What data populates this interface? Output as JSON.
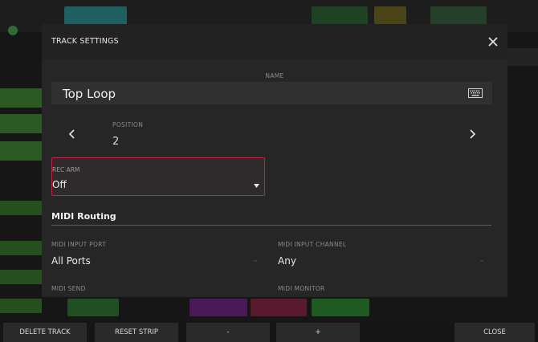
{
  "modal": {
    "title": "TRACK SETTINGS",
    "name_label": "NAME",
    "name_value": "Top Loop",
    "position_label": "POSITION",
    "position_value": "2",
    "rec_arm_label": "REC ARM",
    "rec_arm_value": "Off",
    "midi_section_title": "MIDI Routing",
    "midi_input_port_label": "MIDI INPUT PORT",
    "midi_input_port_value": "All Ports",
    "midi_input_channel_label": "MIDI INPUT CHANNEL",
    "midi_input_channel_value": "Any",
    "midi_send_label": "MIDI SEND",
    "midi_monitor_label": "MIDI MONITOR"
  },
  "bottom_bar": {
    "delete_track": "DELETE TRACK",
    "reset_strip": "RESET STRIP",
    "minus": "-",
    "plus": "+",
    "close": "CLOSE"
  },
  "colors": {
    "accent_red": "#c0243f",
    "modal_bg": "#262626",
    "field_bg": "#303030"
  },
  "icons": {
    "close": "close-icon",
    "keyboard": "keyboard-icon",
    "prev": "chevron-left-icon",
    "next": "chevron-right-icon",
    "dropdown": "dropdown-arrow-icon"
  }
}
